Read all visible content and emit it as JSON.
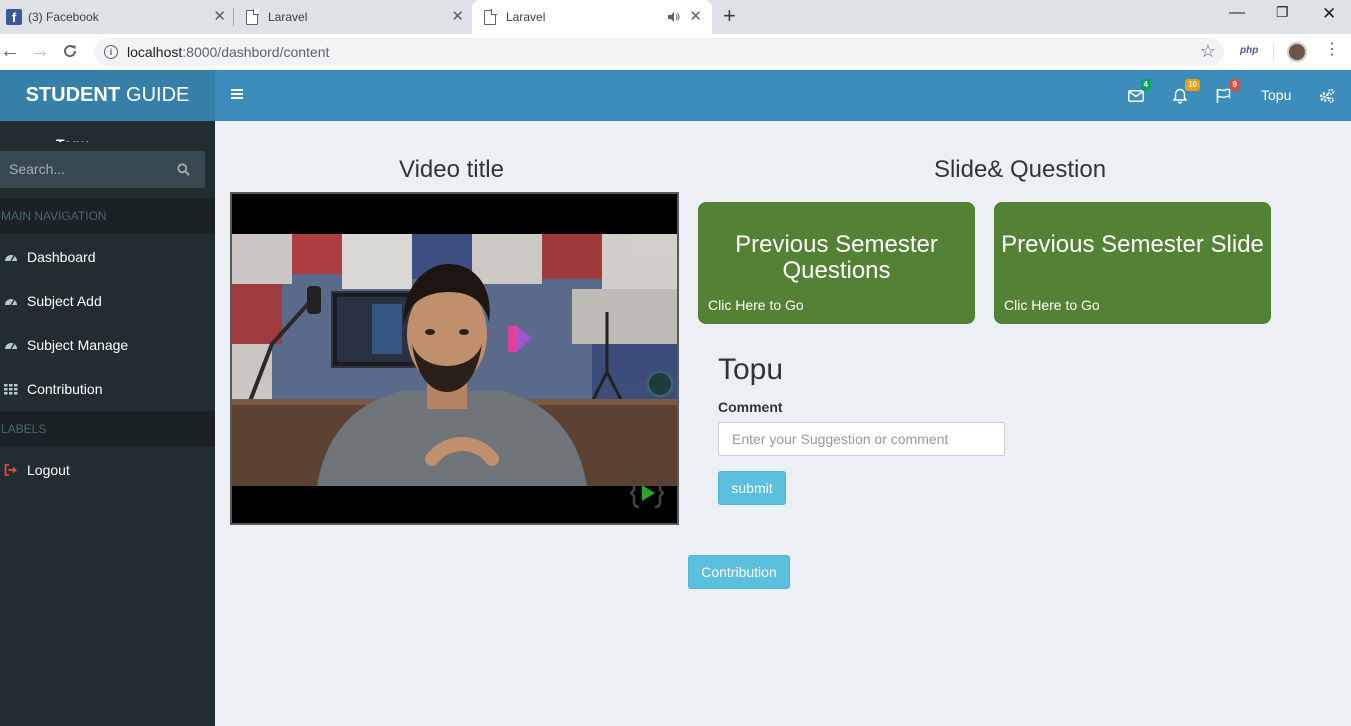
{
  "browser": {
    "tabs": [
      {
        "title": "(3) Facebook",
        "icon": "facebook-icon"
      },
      {
        "title": "Laravel",
        "icon": "page-icon"
      },
      {
        "title": "Laravel",
        "icon": "page-icon",
        "audio": "speaker-icon"
      }
    ],
    "url_host": "localhost",
    "url_rest": ":8000/dashbord/content",
    "extension_label": "php"
  },
  "app": {
    "logo_bold": "STUDENT",
    "logo_rest": "GUIDE",
    "nav": {
      "messages_count": "4",
      "notifications_count": "10",
      "flags_count": "9",
      "user_name": "Topu"
    }
  },
  "sidebar": {
    "user_name": "Topu",
    "search_placeholder": "Search...",
    "main_header": "MAIN NAVIGATION",
    "items": [
      {
        "label": "Dashboard",
        "icon": "dashboard-icon"
      },
      {
        "label": "Subject Add",
        "icon": "dashboard-icon"
      },
      {
        "label": "Subject Manage",
        "icon": "dashboard-icon"
      },
      {
        "label": "Contribution",
        "icon": "grid-icon"
      }
    ],
    "labels_header": "LABELS",
    "logout_label": "Logout"
  },
  "content": {
    "video_title": "Video title",
    "slide_title": "Slide& Question",
    "boxes": [
      {
        "title": "Previous Semester Questions",
        "link": "Clic Here to Go"
      },
      {
        "title": "Previous Semester Slide",
        "link": "Clic Here to Go"
      }
    ],
    "user_heading": "Topu",
    "comment_label": "Comment",
    "comment_placeholder": "Enter your Suggestion or comment",
    "submit_label": "submit",
    "contribution_label": "Contribution"
  },
  "colors": {
    "header": "#3c8dbc",
    "logo_bg": "#367fa9",
    "sidebar": "#222d32",
    "box_green": "#548234",
    "btn_info": "#5bc0de",
    "badge_green": "#00a65a",
    "badge_yellow": "#f39c12",
    "badge_red": "#dd4b39"
  }
}
